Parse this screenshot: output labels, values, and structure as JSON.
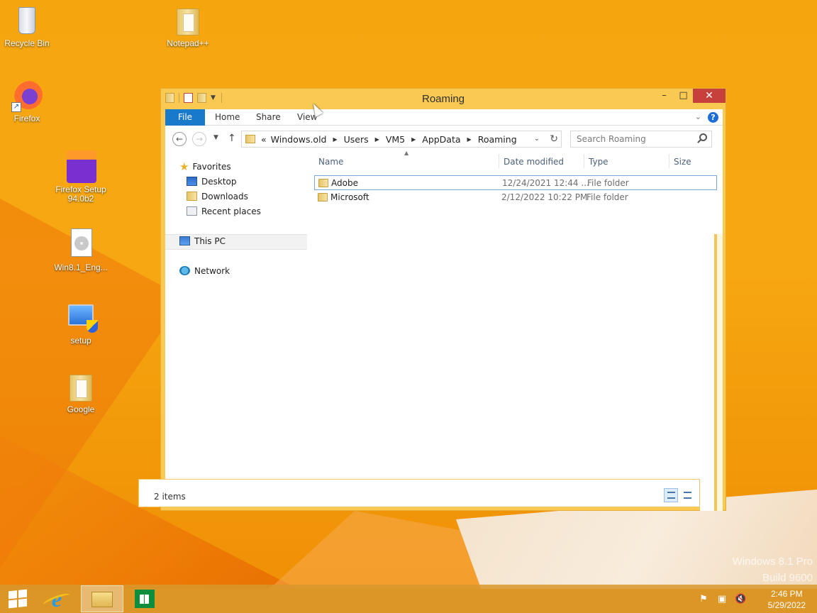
{
  "desktop": {
    "icons": [
      {
        "label": "Recycle Bin",
        "icon": "recycle-bin-icon"
      },
      {
        "label": "Notepad++",
        "icon": "folder-icon"
      },
      {
        "label": "Firefox",
        "icon": "firefox-icon"
      },
      {
        "label": "Firefox Setup 94.0b2",
        "icon": "firefox-setup-icon"
      },
      {
        "label": "Win8.1_Eng...",
        "icon": "disc-image-icon"
      },
      {
        "label": "setup",
        "icon": "setup-icon"
      },
      {
        "label": "Google",
        "icon": "folder-icon"
      }
    ],
    "watermark": {
      "line1": "Windows 8.1 Pro",
      "line2": "Build 9600"
    }
  },
  "window": {
    "title": "Roaming",
    "ribbon_tabs": {
      "file": "File",
      "home": "Home",
      "share": "Share",
      "view": "View"
    },
    "address": {
      "prefix": "«",
      "crumbs": [
        "Windows.old",
        "Users",
        "VM5",
        "AppData",
        "Roaming"
      ]
    },
    "search": {
      "placeholder": "Search Roaming"
    },
    "nav_pane": {
      "favorites": "Favorites",
      "desktop": "Desktop",
      "downloads": "Downloads",
      "recent_places": "Recent places",
      "this_pc": "This PC",
      "network": "Network"
    },
    "columns": {
      "name": "Name",
      "date_modified": "Date modified",
      "type": "Type",
      "size": "Size"
    },
    "files": [
      {
        "name": "Adobe",
        "date": "12/24/2021 12:44 ...",
        "type": "File folder"
      },
      {
        "name": "Microsoft",
        "date": "2/12/2022 10:22 PM",
        "type": "File folder"
      }
    ],
    "status": "2 items"
  },
  "taskbar": {
    "time": "2:46 PM",
    "date": "5/29/2022"
  },
  "colors": {
    "accent": "#1979ca",
    "window_frame": "#f9c951",
    "close_button": "#c7413c"
  }
}
